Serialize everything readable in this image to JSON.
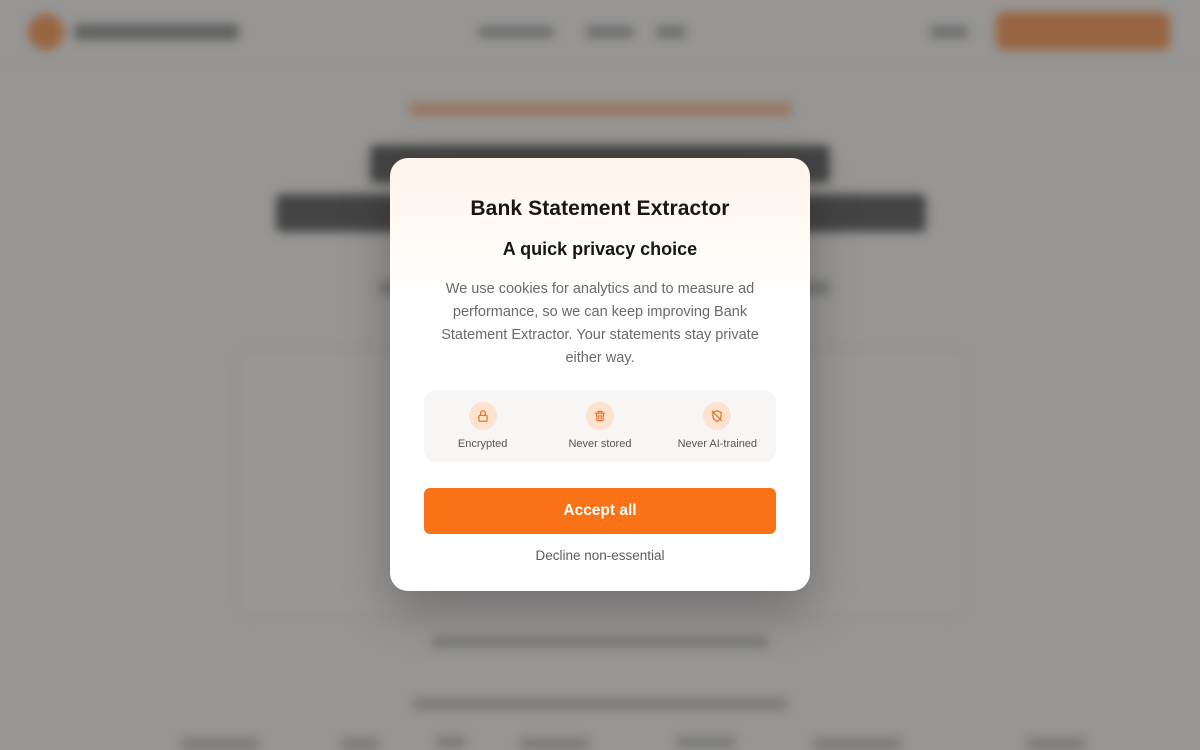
{
  "modal": {
    "title": "Bank Statement Extractor",
    "subtitle": "A quick privacy choice",
    "body": "We use cookies for analytics and to measure ad performance, so we can keep improving Bank Statement Extractor. Your statements stay private either way.",
    "features": [
      {
        "icon": "lock-icon",
        "label": "Encrypted"
      },
      {
        "icon": "trash-icon",
        "label": "Never stored"
      },
      {
        "icon": "shield-off-icon",
        "label": "Never AI-trained"
      }
    ],
    "accept_label": "Accept all",
    "decline_label": "Decline non-essential"
  },
  "colors": {
    "accent": "#f97316",
    "icon_bg": "#fde3cf",
    "overlay": "#5c5c5c"
  }
}
